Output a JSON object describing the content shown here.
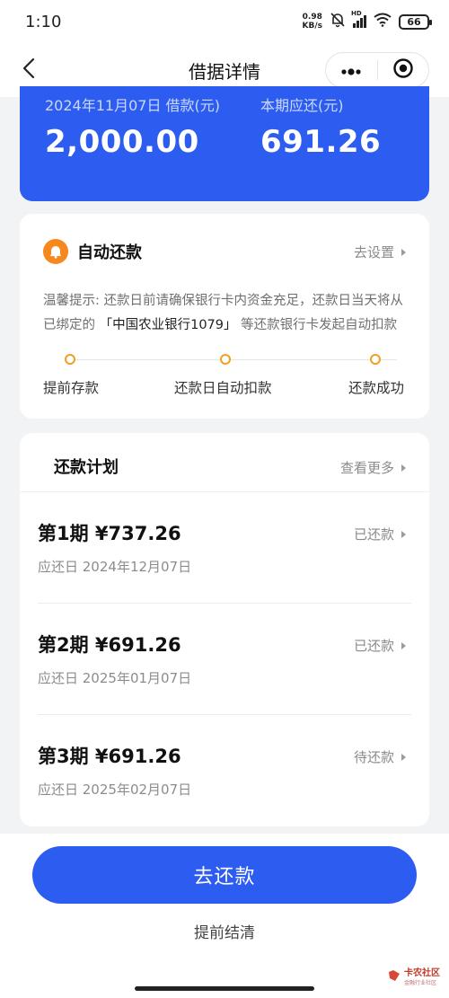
{
  "status_bar": {
    "time": "1:10",
    "net_speed_value": "0.98",
    "net_speed_unit": "KB/s",
    "network_type": "HD",
    "battery": "66"
  },
  "nav": {
    "title": "借据详情",
    "icons": [
      "back-arrow-icon",
      "more-dots-icon",
      "close-target-icon"
    ]
  },
  "loan": {
    "left_label": "2024年11月07日 借款(元)",
    "left_amount": "2,000.00",
    "right_label": "本期应还(元)",
    "right_amount": "691.26"
  },
  "auto_repay": {
    "title": "自动还款",
    "link": "去设置",
    "tip_prefix": "温馨提示: 还款日前请确保银行卡内资金充足，还款日当天将从已绑定的 ",
    "bank": "「中国农业银行1079」",
    "tip_suffix": " 等还款银行卡发起自动扣款",
    "steps": [
      "提前存款",
      "还款日自动扣款",
      "还款成功"
    ]
  },
  "plan": {
    "title": "还款计划",
    "more": "查看更多",
    "rows": [
      {
        "period": "第1期 ¥737.26",
        "due": "应还日 2024年12月07日",
        "status": "已还款"
      },
      {
        "period": "第2期 ¥691.26",
        "due": "应还日 2025年01月07日",
        "status": "已还款"
      },
      {
        "period": "第3期 ¥691.26",
        "due": "应还日 2025年02月07日",
        "status": "待还款"
      }
    ]
  },
  "actions": {
    "pay": "去还款",
    "settle": "提前结清"
  },
  "watermark": {
    "text": "卡农社区",
    "sub": "金融行业社区"
  },
  "colors": {
    "primary": "#2c5df0",
    "accent_orange": "#f7881d",
    "background": "#f2f3f5"
  }
}
